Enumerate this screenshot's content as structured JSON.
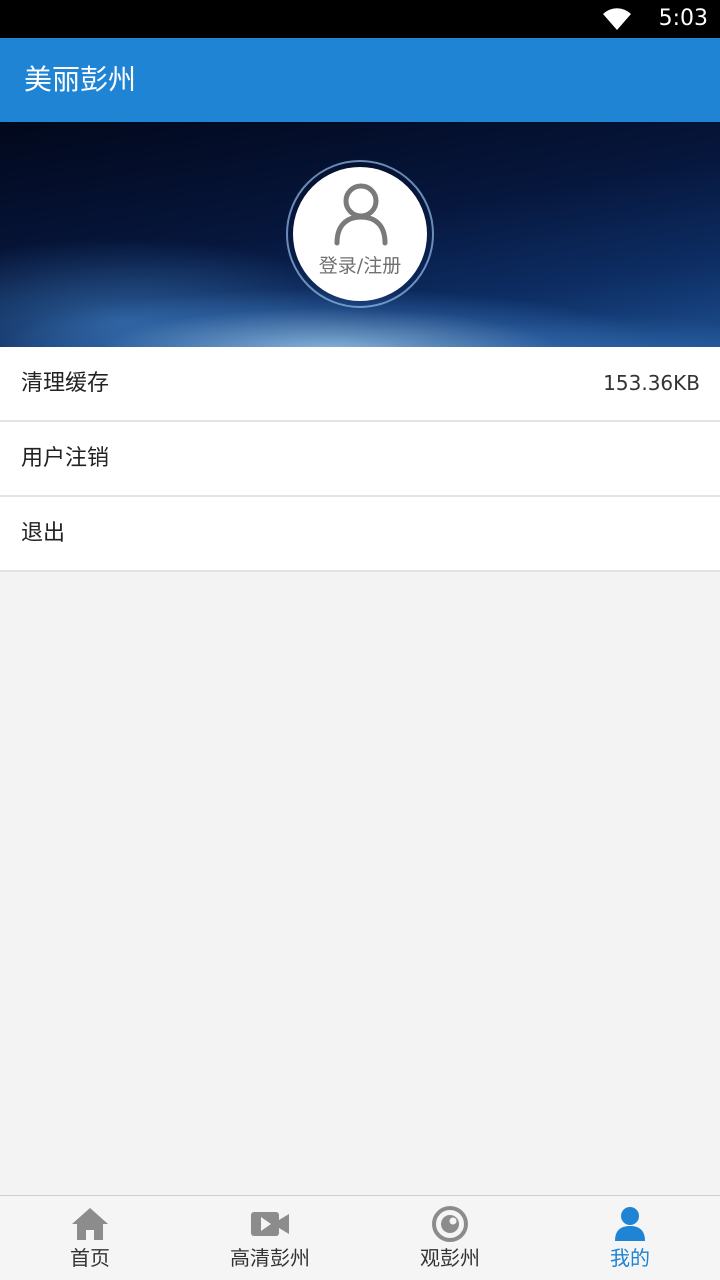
{
  "status_bar": {
    "time": "5:03",
    "wifi_icon": "wifi-icon"
  },
  "app_bar": {
    "title": "美丽彭州"
  },
  "profile": {
    "avatar_icon": "person-icon",
    "login_label": "登录/注册"
  },
  "menu": {
    "items": [
      {
        "label": "清理缓存",
        "value": "153.36KB"
      },
      {
        "label": "用户注销",
        "value": ""
      },
      {
        "label": "退出",
        "value": ""
      }
    ]
  },
  "bottom_nav": {
    "active_color": "#1f84d4",
    "inactive_color": "#8c8c8c",
    "items": [
      {
        "label": "首页",
        "icon": "home-icon",
        "active": false
      },
      {
        "label": "高清彭州",
        "icon": "video-camera-icon",
        "active": false
      },
      {
        "label": "观彭州",
        "icon": "eye-icon",
        "active": false
      },
      {
        "label": "我的",
        "icon": "user-icon",
        "active": true
      }
    ]
  },
  "colors": {
    "primary": "#1f84d4",
    "background": "#f3f3f3"
  }
}
